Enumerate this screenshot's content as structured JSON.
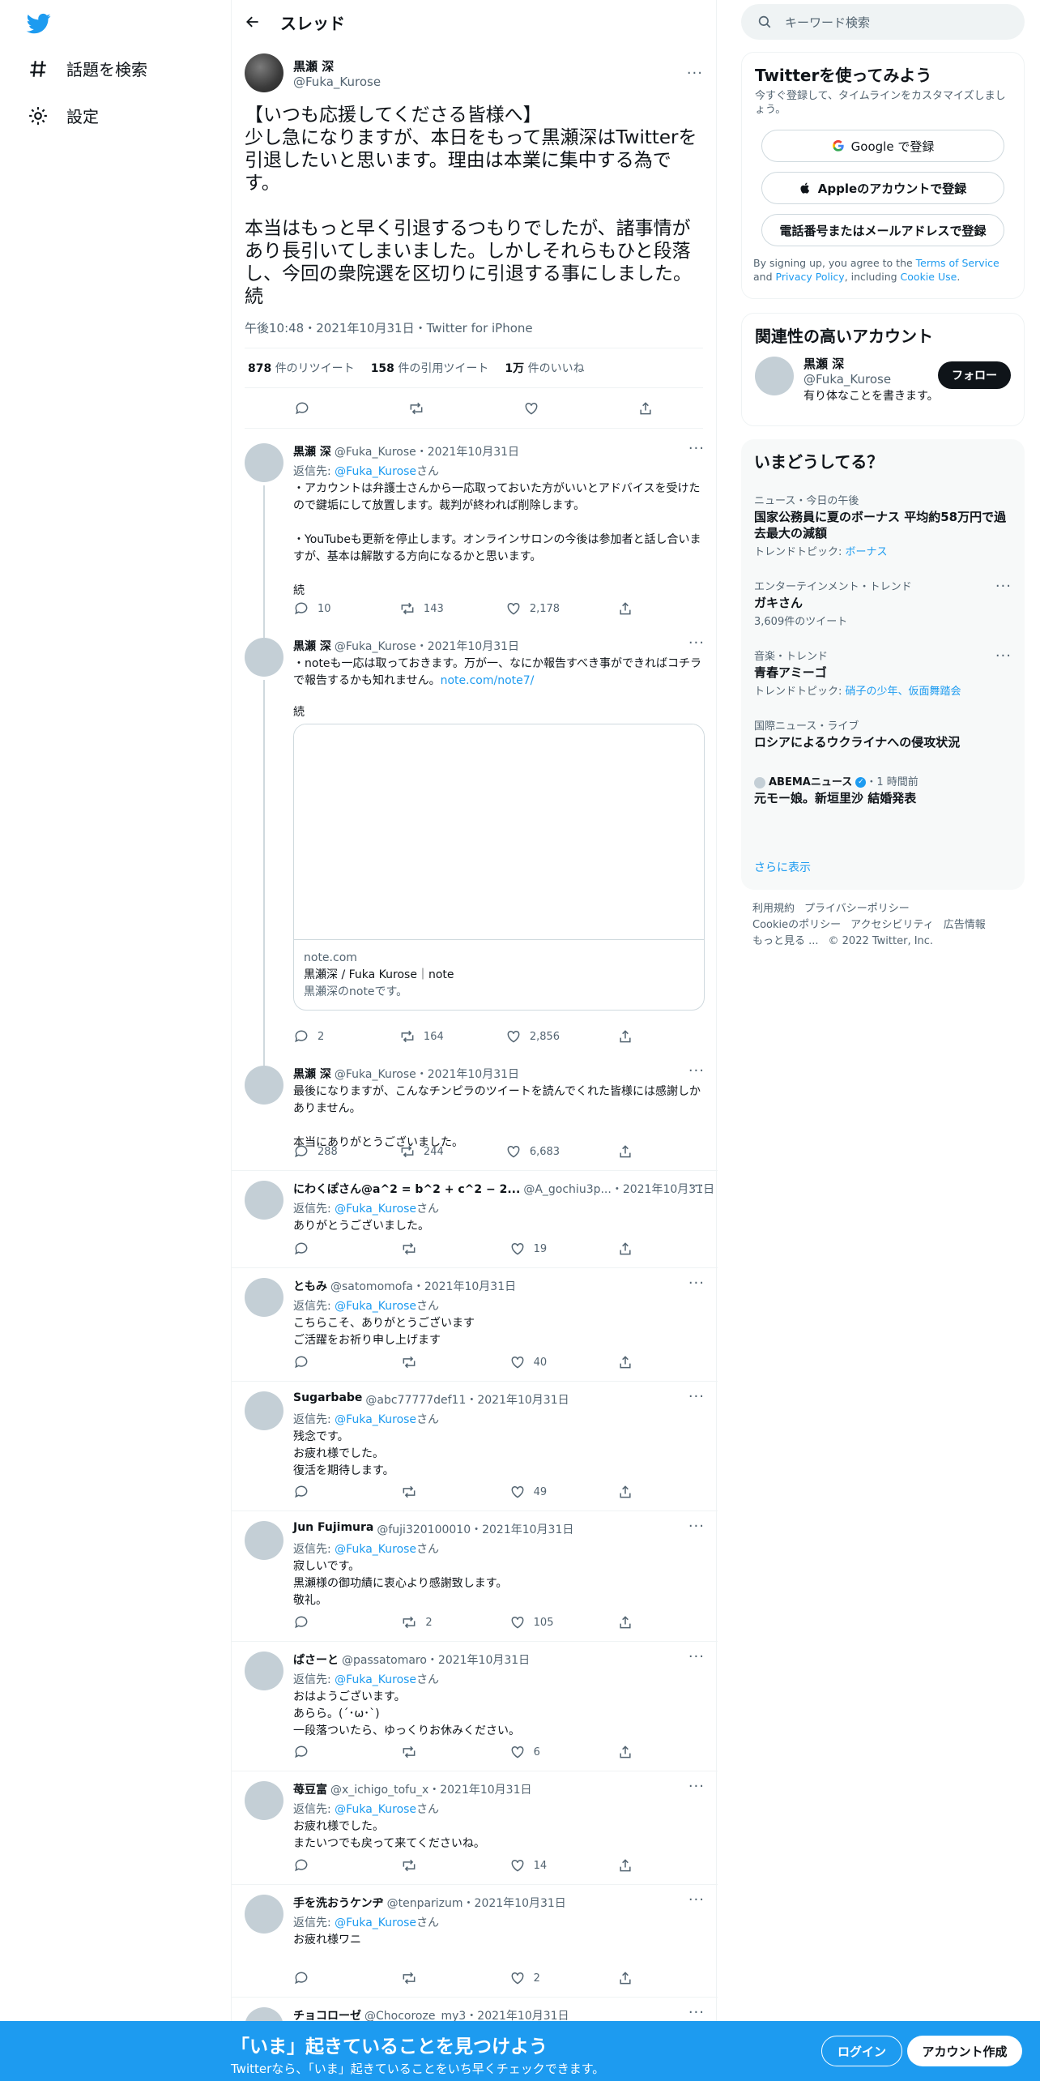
{
  "nav": {
    "explore": "話題を検索",
    "settings": "設定"
  },
  "header": {
    "title": "スレッド"
  },
  "focal": {
    "name": "黒瀬 深",
    "handle": "@Fuka_Kurose",
    "text": "【いつも応援してくださる皆様へ】\n少し急になりますが、本日をもって黒瀬深はTwitterを引退したいと思います。理由は本業に集中する為です。\n\n本当はもっと早く引退するつもりでしたが、諸事情があり長引いてしまいました。しかしそれらもひと段落し、今回の衆院選を区切りに引退する事にしました。続",
    "meta": "午後10:48・2021年10月31日・Twitter for iPhone",
    "retweets_n": "878",
    "retweets_l": "件のリツイート",
    "quotes_n": "158",
    "quotes_l": "件の引用ツイート",
    "likes_n": "1万",
    "likes_l": "件のいいね"
  },
  "tweets": [
    {
      "name": "黒瀬 深",
      "handle": "@Fuka_Kurose・2021年10月31日",
      "reply_prefix": "返信先: ",
      "reply_to": "@Fuka_Kurose",
      "reply_suffix": "さん",
      "text": "・アカウントは弁護士さんから一応取っておいた方がいいとアドバイスを受けたので鍵垢にして放置します。裁判が終われば削除します。\n\n・YouTubeも更新を停止します。オンラインサロンの今後は参加者と話し合いますが、基本は解散する方向になるかと思います。\n\n続",
      "replies": "10",
      "retweets": "143",
      "likes": "2,178"
    },
    {
      "name": "黒瀬 深",
      "handle": "@Fuka_Kurose・2021年10月31日",
      "text": "・noteも一応は取っておきます。万が一、なにか報告すべき事ができればコチラで報告するかも知れません。",
      "link": "note.com/note7/",
      "text2": "続",
      "card_domain": "note.com",
      "card_title": "黒瀬深 / Fuka Kurose｜note",
      "card_desc": "黒瀬深のnoteです。",
      "replies": "2",
      "retweets": "164",
      "likes": "2,856"
    },
    {
      "name": "黒瀬 深",
      "handle": "@Fuka_Kurose・2021年10月31日",
      "text": "最後になりますが、こんなチンピラのツイートを読んでくれた皆様には感謝しかありません。\n\n本当にありがとうございました。",
      "replies": "288",
      "retweets": "244",
      "likes": "6,683"
    },
    {
      "name": "にわくぽさん@a^2 = b^2 + c^2 − 2...",
      "handle": "@A_gochiu3p...・2021年10月31日",
      "reply_prefix": "返信先: ",
      "reply_to": "@Fuka_Kurose",
      "reply_suffix": "さん",
      "text": "ありがとうございました。",
      "replies": "",
      "retweets": "",
      "likes": "19"
    },
    {
      "name": "ともみ",
      "handle": "@satomomofa・2021年10月31日",
      "reply_prefix": "返信先: ",
      "reply_to": "@Fuka_Kurose",
      "reply_suffix": "さん",
      "text": "こちらこそ、ありがとうございます\nご活躍をお祈り申し上げます",
      "replies": "",
      "retweets": "",
      "likes": "40"
    },
    {
      "name": "Sugarbabe",
      "handle": "@abc77777def11・2021年10月31日",
      "reply_prefix": "返信先: ",
      "reply_to": "@Fuka_Kurose",
      "reply_suffix": "さん",
      "text": "残念です。\nお疲れ様でした。\n復活を期待します。",
      "replies": "",
      "retweets": "",
      "likes": "49"
    },
    {
      "name": "Jun Fujimura",
      "handle": "@fuji320100010・2021年10月31日",
      "reply_prefix": "返信先: ",
      "reply_to": "@Fuka_Kurose",
      "reply_suffix": "さん",
      "text": "寂しいです。\n黒瀬様の御功績に衷心より感謝致します。\n敬礼。",
      "replies": "",
      "retweets": "2",
      "likes": "105"
    },
    {
      "name": "ぱさーと",
      "handle": "@passatomaro・2021年10月31日",
      "reply_prefix": "返信先: ",
      "reply_to": "@Fuka_Kurose",
      "reply_suffix": "さん",
      "text": "おはようございます。\nあらら。(´･ω･`)\n一段落ついたら、ゆっくりお休みください。",
      "replies": "",
      "retweets": "",
      "likes": "6"
    },
    {
      "name": "苺豆富",
      "handle": "@x_ichigo_tofu_x・2021年10月31日",
      "reply_prefix": "返信先: ",
      "reply_to": "@Fuka_Kurose",
      "reply_suffix": "さん",
      "text": "お疲れ様でした。\nまたいつでも戻って来てくださいね。",
      "replies": "",
      "retweets": "",
      "likes": "14"
    },
    {
      "name": "手を洗おうケンヂ",
      "handle": "@tenparizum・2021年10月31日",
      "reply_prefix": "返信先: ",
      "reply_to": "@Fuka_Kurose",
      "reply_suffix": "さん",
      "text": "お疲れ様ワニ",
      "replies": "",
      "retweets": "",
      "likes": "2"
    },
    {
      "name": "チョコローゼ",
      "handle": "@Chocoroze_my3・2021年10月31日"
    }
  ],
  "right": {
    "search_placeholder": "キーワード検索",
    "signup": {
      "title": "Twitterを使ってみよう",
      "sub": "今すぐ登録して、タイムラインをカスタマイズしましょう。",
      "google": "Google で登録",
      "apple": "Appleのアカウントで登録",
      "phone": "電話番号またはメールアドレスで登録",
      "terms_a": "By signing up, you agree to the ",
      "terms_tos": "Terms of Service",
      "terms_b": " and ",
      "terms_pp": "Privacy Policy",
      "terms_c": ", including ",
      "terms_cookie": "Cookie Use",
      "terms_d": "."
    },
    "related": {
      "title": "関連性の高いアカウント",
      "name": "黒瀬 深",
      "handle": "@Fuka_Kurose",
      "bio": "有り体なことを書きます。",
      "follow": "フォロー"
    },
    "trends": {
      "title": "いまどうしてる？",
      "items": [
        {
          "cat": "ニュース・今日の午後",
          "title": "国家公務員に夏のボーナス 平均約58万円で過去最大の減額",
          "sub_a": "トレンドトピック: ",
          "sub_b": "ボーナス"
        },
        {
          "cat": "エンターテインメント・トレンド",
          "title": "ガキさん",
          "sub_a": "3,609件のツイート",
          "sub_b": ""
        },
        {
          "cat": "音楽・トレンド",
          "title": "青春アミーゴ",
          "sub_a": "トレンドトピック: ",
          "sub_b": "硝子の少年、仮面舞踏会"
        },
        {
          "cat": "国際ニュース・ライブ",
          "title": "ロシアによるウクライナへの侵攻状況",
          "sub_a": "",
          "sub_b": ""
        },
        {
          "cat": "ABEMAニュース",
          "cat_b": "・1 時間前",
          "title": "元モー娘。新垣里沙 結婚発表",
          "sub_a": "",
          "sub_b": ""
        }
      ],
      "more": "さらに表示"
    },
    "footer": [
      "利用規約",
      "プライバシーポリシー",
      "Cookieのポリシー",
      "アクセシビリティ",
      "広告情報",
      "もっと見る ...",
      "© 2022 Twitter, Inc."
    ]
  },
  "bottom": {
    "title": "「いま」起きていることを見つけよう",
    "sub": "Twitterなら、「いま」起きていることをいち早くチェックできます。",
    "login": "ログイン",
    "signup": "アカウント作成"
  },
  "colors": {
    "accent": "#1d9bf0",
    "text": "#0f1419",
    "muted": "#536471"
  }
}
